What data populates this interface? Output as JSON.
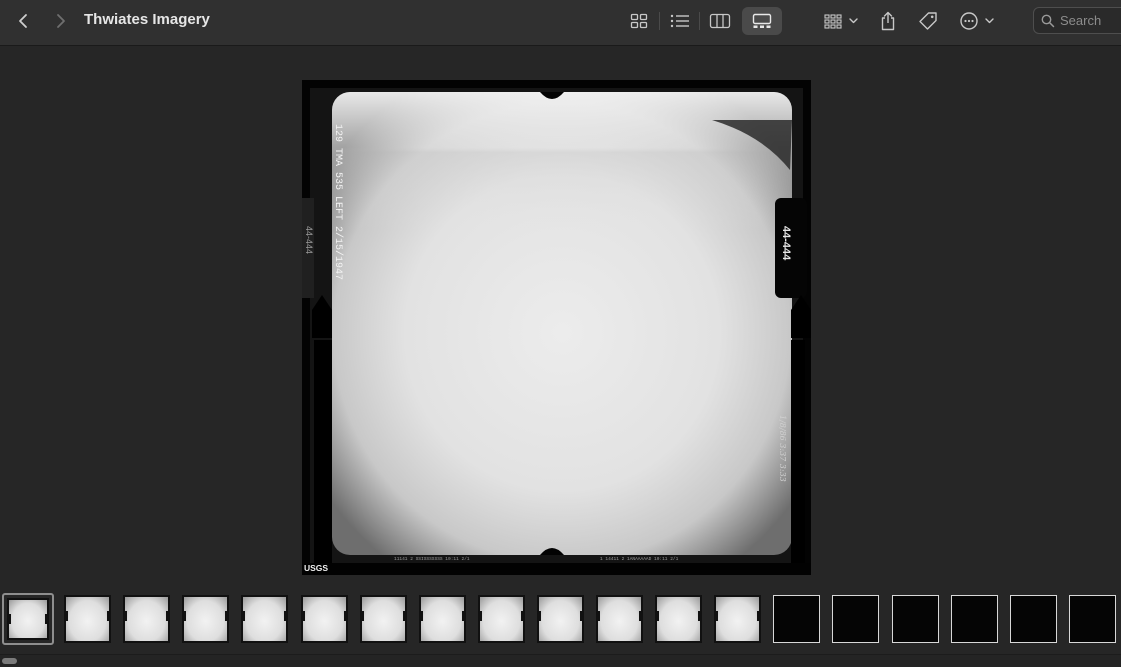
{
  "window": {
    "title": "Thwiates Imagery"
  },
  "toolbar": {
    "back_icon": "chevron-left-icon",
    "forward_icon": "chevron-right-icon",
    "view_modes": [
      {
        "name": "icon-view",
        "icon": "grid-icon",
        "active": false
      },
      {
        "name": "list-view",
        "icon": "list-icon",
        "active": false
      },
      {
        "name": "column-view",
        "icon": "columns-icon",
        "active": false
      },
      {
        "name": "gallery-view",
        "icon": "gallery-icon",
        "active": true
      }
    ],
    "group_icon": "group-by-icon",
    "share_icon": "share-icon",
    "tag_icon": "tag-icon",
    "more_icon": "ellipsis-circle-icon",
    "search": {
      "placeholder": "Search",
      "value": ""
    }
  },
  "preview": {
    "side_label_left": "129 TMA 535 LEFT 2/15/1947",
    "frame_number": "44-444",
    "frame_number_left": "44-444",
    "handwritten_right": "1/8/86 3:37 3:33",
    "bottom_caption_1": "11141 2 SSISSSSSSS 10:11   2/1",
    "bottom_caption_2": "1 14411 2 1ANAAAAAD 10:11   2/1",
    "agency_mark": "USGS"
  },
  "filmstrip": {
    "thumbnails": [
      {
        "tone": "light",
        "selected": true
      },
      {
        "tone": "light",
        "selected": false
      },
      {
        "tone": "light",
        "selected": false
      },
      {
        "tone": "light",
        "selected": false
      },
      {
        "tone": "light",
        "selected": false
      },
      {
        "tone": "light",
        "selected": false
      },
      {
        "tone": "light",
        "selected": false
      },
      {
        "tone": "light",
        "selected": false
      },
      {
        "tone": "light",
        "selected": false
      },
      {
        "tone": "light",
        "selected": false
      },
      {
        "tone": "light",
        "selected": false
      },
      {
        "tone": "light",
        "selected": false
      },
      {
        "tone": "light",
        "selected": false
      },
      {
        "tone": "dark",
        "selected": false
      },
      {
        "tone": "dark",
        "selected": false
      },
      {
        "tone": "dark",
        "selected": false
      },
      {
        "tone": "dark",
        "selected": false
      },
      {
        "tone": "dark",
        "selected": false
      },
      {
        "tone": "dark",
        "selected": false
      }
    ]
  },
  "colors": {
    "toolbar_bg": "#303030",
    "window_bg": "#262626",
    "active_view_bg": "#4a4a4a",
    "icon_color": "#c8c8c8"
  }
}
